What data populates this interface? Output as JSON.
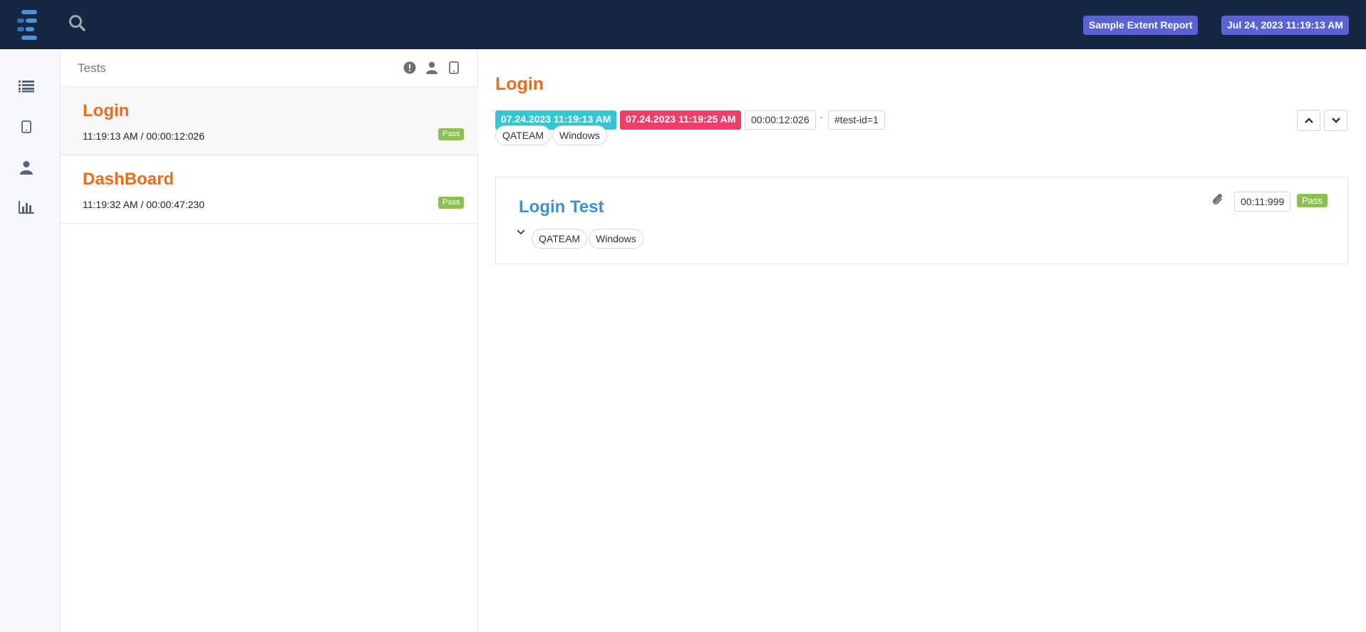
{
  "header": {
    "report_name": "Sample Extent Report",
    "report_date": "Jul 24, 2023 11:19:13 AM",
    "logo_icon": "extent-logo-icon",
    "search_icon": "search-icon"
  },
  "sidenav": {
    "items": [
      {
        "icon": "list-icon",
        "label": "Tests"
      },
      {
        "icon": "tablet-icon",
        "label": "Devices"
      },
      {
        "icon": "user-icon",
        "label": "Authors"
      },
      {
        "icon": "bar-chart-icon",
        "label": "Dashboard"
      }
    ]
  },
  "test_list": {
    "title": "Tests",
    "filters": [
      "status-filter-icon",
      "author-filter-icon",
      "device-filter-icon"
    ],
    "tests": [
      {
        "name": "Login",
        "meta": "11:19:13 AM / 00:00:12:026",
        "status": "Pass",
        "active": true
      },
      {
        "name": "DashBoard",
        "meta": "11:19:32 AM / 00:00:47:230",
        "status": "Pass",
        "active": false
      }
    ]
  },
  "detail": {
    "title": "Login",
    "start_time": "07.24.2023 11:19:13 AM",
    "end_time": "07.24.2023 11:19:25 AM",
    "duration": "00:00:12:026",
    "separator": "·",
    "test_id": "#test-id=1",
    "tags": [
      "QATEAM",
      "Windows"
    ],
    "colors": {
      "start": "#36c6d3",
      "end": "#f03e6a",
      "title": "#ed6a1e",
      "pass": "#8cc152"
    }
  },
  "node": {
    "name": "Login Test",
    "duration": "00:11:999",
    "status": "Pass",
    "tags": [
      "QATEAM",
      "Windows"
    ],
    "attachment_icon": "paperclip-icon",
    "toggle_icon": "chevron-down-icon",
    "title_color": "#3f8fd2"
  }
}
